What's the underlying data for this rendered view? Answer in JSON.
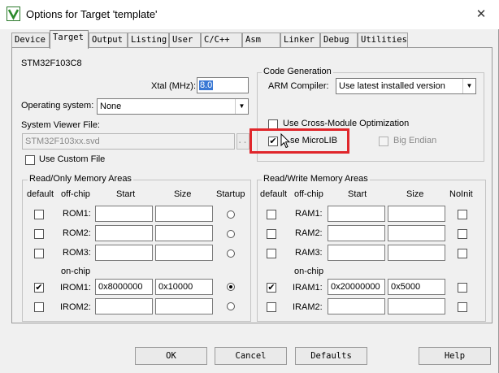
{
  "window": {
    "title": "Options for Target 'template'",
    "close_glyph": "✕",
    "icon": "keil-uvision-icon"
  },
  "tabs": [
    "Device",
    "Target",
    "Output",
    "Listing",
    "User",
    "C/C++",
    "Asm",
    "Linker",
    "Debug",
    "Utilities"
  ],
  "active_tab": "Target",
  "device_name": "STM32F103C8",
  "xtal": {
    "label": "Xtal (MHz):",
    "value": "8.0"
  },
  "os": {
    "label": "Operating system:",
    "value": "None"
  },
  "svd": {
    "label": "System Viewer File:",
    "value": "STM32F103xx.svd",
    "browse_label": "..."
  },
  "custom_file": {
    "label": "Use Custom File",
    "checked": false
  },
  "code_gen": {
    "title": "Code Generation",
    "compiler_label": "ARM Compiler:",
    "compiler_value": "Use latest installed version",
    "cross_module_label": "Use Cross-Module Optimization",
    "microlib_label": "Use MicroLIB",
    "microlib_visible_label": "se MicroLIB",
    "microlib_checked": true,
    "big_endian_label": "Big Endian",
    "big_endian_checked": false
  },
  "ro_memory": {
    "title": "Read/Only Memory Areas",
    "headers": {
      "default": "default",
      "offchip": "off-chip",
      "start": "Start",
      "size": "Size",
      "extra": "Startup"
    },
    "onchip_label": "on-chip",
    "rows": [
      {
        "name": "ROM1:",
        "start": "",
        "size": "",
        "default": false,
        "selected": false
      },
      {
        "name": "ROM2:",
        "start": "",
        "size": "",
        "default": false,
        "selected": false
      },
      {
        "name": "ROM3:",
        "start": "",
        "size": "",
        "default": false,
        "selected": false
      },
      {
        "name": "IROM1:",
        "start": "0x8000000",
        "size": "0x10000",
        "default": true,
        "selected": true
      },
      {
        "name": "IROM2:",
        "start": "",
        "size": "",
        "default": false,
        "selected": false
      }
    ]
  },
  "rw_memory": {
    "title": "Read/Write Memory Areas",
    "headers": {
      "default": "default",
      "offchip": "off-chip",
      "start": "Start",
      "size": "Size",
      "extra": "NoInit"
    },
    "onchip_label": "on-chip",
    "rows": [
      {
        "name": "RAM1:",
        "start": "",
        "size": "",
        "default": false,
        "noinit": false
      },
      {
        "name": "RAM2:",
        "start": "",
        "size": "",
        "default": false,
        "noinit": false
      },
      {
        "name": "RAM3:",
        "start": "",
        "size": "",
        "default": false,
        "noinit": false
      },
      {
        "name": "IRAM1:",
        "start": "0x20000000",
        "size": "0x5000",
        "default": true,
        "noinit": false
      },
      {
        "name": "IRAM2:",
        "start": "",
        "size": "",
        "default": false,
        "noinit": false
      }
    ]
  },
  "buttons": {
    "ok": "OK",
    "cancel": "Cancel",
    "defaults": "Defaults",
    "help": "Help"
  },
  "highlight_color": "#e0262b",
  "check_glyph": "✔"
}
